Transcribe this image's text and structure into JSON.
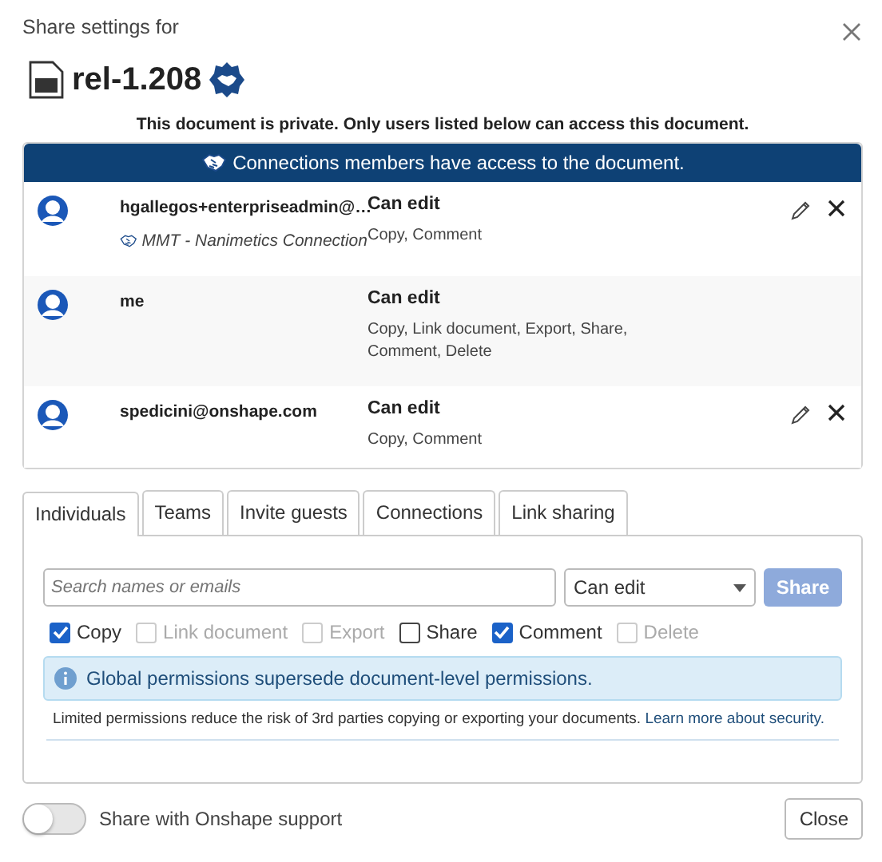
{
  "dialog": {
    "title": "Share settings for",
    "document_name": "rel-1.208",
    "privacy_note": "This document is private. Only users listed below can access this document.",
    "banner": "Connections members have access to the document.",
    "members": [
      {
        "name": "hgallegos+enterpriseadmin@…",
        "connection": "MMT - Nanimetics Connection",
        "role": "Can edit",
        "permissions": "Copy, Comment",
        "editable": true,
        "highlighted": false
      },
      {
        "name": "me",
        "role": "Can edit",
        "permissions": "Copy, Link document, Export, Share, Comment, Delete",
        "editable": false,
        "highlighted": true
      },
      {
        "name": "spedicini@onshape.com",
        "role": "Can edit",
        "permissions": "Copy, Comment",
        "editable": true,
        "highlighted": false
      }
    ],
    "tabs": [
      {
        "label": "Individuals",
        "selected": true
      },
      {
        "label": "Teams",
        "selected": false
      },
      {
        "label": "Invite guests",
        "selected": false
      },
      {
        "label": "Connections",
        "selected": false
      },
      {
        "label": "Link sharing",
        "selected": false
      }
    ],
    "search": {
      "placeholder": "Search names or emails"
    },
    "role_select": {
      "value": "Can edit"
    },
    "share_button": {
      "label": "Share",
      "disabled": true
    },
    "permissions": [
      {
        "label": "Copy",
        "checked": true,
        "disabled": false
      },
      {
        "label": "Link document",
        "checked": false,
        "disabled": true
      },
      {
        "label": "Export",
        "checked": false,
        "disabled": true
      },
      {
        "label": "Share",
        "checked": false,
        "disabled": false
      },
      {
        "label": "Comment",
        "checked": true,
        "disabled": false
      },
      {
        "label": "Delete",
        "checked": false,
        "disabled": true
      }
    ],
    "info": "Global permissions supersede document-level permissions.",
    "note": {
      "text": "Limited permissions reduce the risk of 3rd parties copying or exporting your documents.",
      "link": "Learn more about security."
    },
    "support_toggle": {
      "label": "Share with Onshape support",
      "on": false
    },
    "close_button": "Close"
  }
}
